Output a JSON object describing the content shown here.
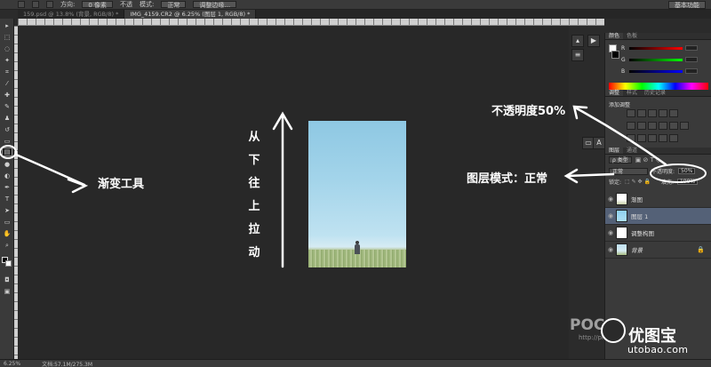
{
  "options_bar": {
    "opacity_label": "不透",
    "offset_label": "方向:",
    "offset_value": "0 像素",
    "mode_label": "模式:",
    "mode_value": "正常",
    "sample_label": "调整边缘...",
    "workspace_label": "基本功能"
  },
  "tabs": [
    {
      "label": "159.psd @ 13.8% (背景, RGB/8) *",
      "active": false
    },
    {
      "label": "IMG_4159.CR2 @ 6.25% (图层 1, RGB/8) *",
      "active": true
    }
  ],
  "photo": {
    "sky_color": "#9fd2ea",
    "grass_color": "#a6ba80"
  },
  "annotations": {
    "gradient_tool": "渐变工具",
    "vertical_chars": [
      "从",
      "下",
      "往",
      "上",
      "拉",
      "动"
    ],
    "opacity_note": "不透明度50%",
    "blend_note": "图层模式：正常"
  },
  "panels": {
    "color_tabs": [
      "颜色",
      "色板"
    ],
    "rgb": [
      {
        "label": "R",
        "gradient": "linear-gradient(90deg,#000,#f00)"
      },
      {
        "label": "G",
        "gradient": "linear-gradient(90deg,#000,#0f0)"
      },
      {
        "label": "B",
        "gradient": "linear-gradient(90deg,#000,#00f)"
      }
    ],
    "adjust_tabs": [
      "调整",
      "样式",
      "历史记录"
    ],
    "adjust_title": "添加调整",
    "layers_tabs": [
      "图层",
      "通道"
    ],
    "kind_value": "ρ 类型",
    "blend_value": "正常",
    "opacity_label": "不透明度:",
    "opacity_value": "50%",
    "lock_label": "锁定:",
    "fill_label": "填充:",
    "fill_value": "100%"
  },
  "layers": [
    {
      "name": "渐图",
      "thumb": "linear-gradient(180deg,#fff 0%,#fff 55%,#c7cfa8 100%)",
      "active": false
    },
    {
      "name": "图层 1",
      "thumb": "linear-gradient(180deg,#8fd0f0,#aee0f4)",
      "active": true
    },
    {
      "name": "调整构图",
      "thumb": "#ffffff",
      "active": false
    },
    {
      "name": "背景",
      "thumb": "linear-gradient(180deg,#bfe0f0 0%,#d7ecf3 60%,#a6ba80 100%)",
      "active": false
    }
  ],
  "status": {
    "zoom": "6.25%",
    "doc": "文档:57.1M/275.3M"
  },
  "watermark": {
    "poco": "POCO",
    "poco_sub": "http://photo",
    "brand": "优图宝",
    "url": "utobao.com"
  }
}
